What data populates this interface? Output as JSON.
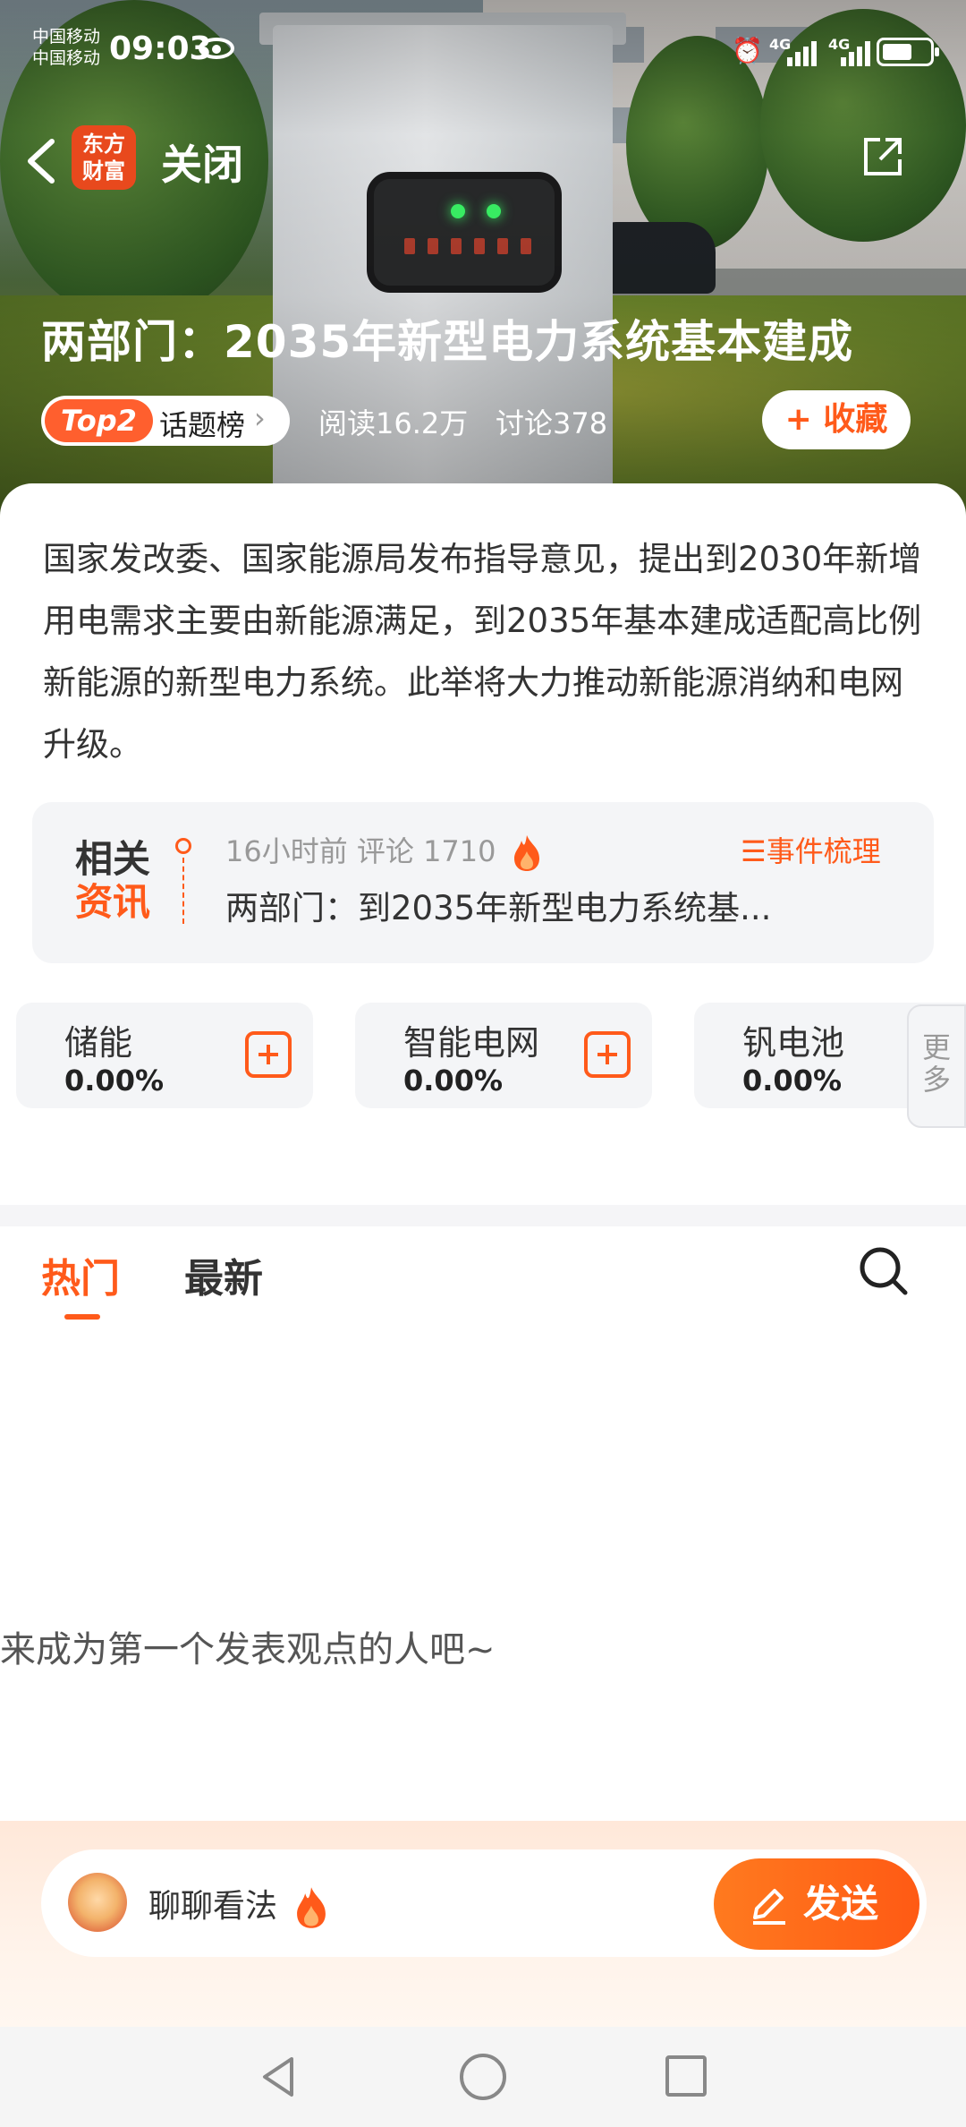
{
  "status_bar": {
    "carrier_1": "中国移动",
    "carrier_2": "中国移动",
    "time": "09:03",
    "network": "4G"
  },
  "nav": {
    "logo_line1": "东方",
    "logo_line2": "财富",
    "close_label": "关闭"
  },
  "topic": {
    "title": "两部门：2035年新型电力系统基本建成",
    "rank_badge": "Top2",
    "rank_label": "话题榜",
    "reads": "阅读16.2万",
    "discussions": "讨论378",
    "favorite_label": "+ 收藏"
  },
  "summary": "国家发改委、国家能源局发布指导意见，提出到2030年新增用电需求主要由新能源满足，到2035年基本建成适配高比例新能源的新型电力系统。此举将大力推动新能源消纳和电网升级。",
  "related": {
    "tag_line1": "相关",
    "tag_line2": "资讯",
    "meta": "16小时前 评论 1710",
    "headline": "两部门：到2035年新型电力系统基...",
    "event_link": "☰事件梳理"
  },
  "concepts": [
    {
      "name": "储能",
      "change": "0.00%"
    },
    {
      "name": "智能电网",
      "change": "0.00%"
    },
    {
      "name": "钒电池",
      "change": "0.00%"
    }
  ],
  "more_label": "更多",
  "tabs": {
    "hot": "热门",
    "latest": "最新"
  },
  "empty_state": "来成为第一个发表观点的人吧~",
  "composer": {
    "placeholder": "聊聊看法",
    "send_label": "发送"
  },
  "colors": {
    "accent": "#ff5a1a",
    "card_bg": "#f4f5f7"
  }
}
